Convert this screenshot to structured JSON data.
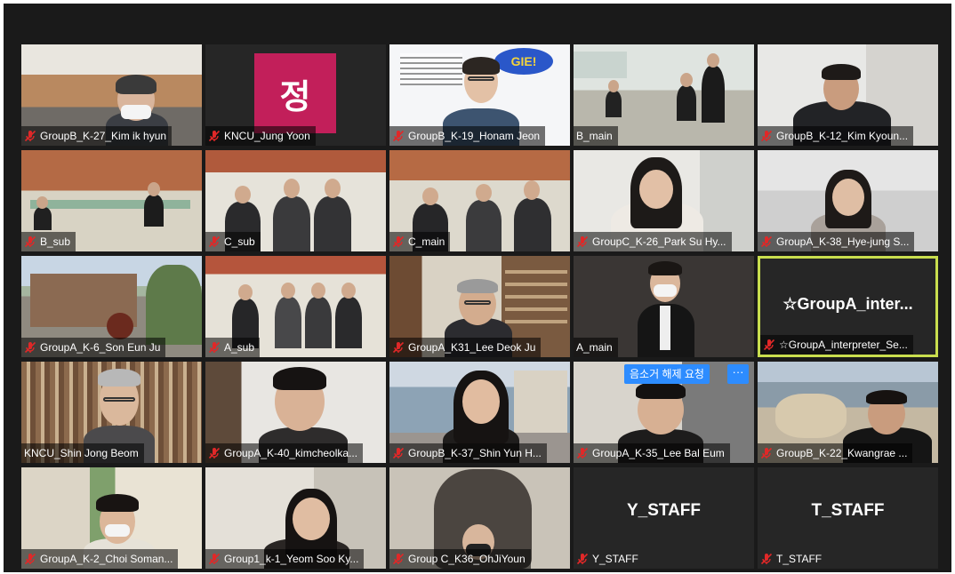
{
  "tiles": [
    {
      "name": "GroupB_K-27_Kim ik hyun",
      "muted": true
    },
    {
      "name": "KNCU_Jung Yoon",
      "muted": true,
      "avatar": "정"
    },
    {
      "name": "GroupB_K-19_Honam Jeon",
      "muted": true,
      "sign_text": "GIE!"
    },
    {
      "name": "B_main",
      "muted": false
    },
    {
      "name": "GroupB_K-12_Kim Kyoun...",
      "muted": true
    },
    {
      "name": "B_sub",
      "muted": true
    },
    {
      "name": "C_sub",
      "muted": true
    },
    {
      "name": "C_main",
      "muted": true
    },
    {
      "name": "GroupC_K-26_Park Su Hy...",
      "muted": true
    },
    {
      "name": "GroupA_K-38_Hye-jung S...",
      "muted": true
    },
    {
      "name": "GroupA_K-6_Son Eun Ju",
      "muted": true
    },
    {
      "name": "A_sub",
      "muted": true
    },
    {
      "name": "GroupA_K31_Lee Deok Ju",
      "muted": true
    },
    {
      "name": "A_main",
      "muted": false
    },
    {
      "name": "☆GroupA_interpreter_Se...",
      "muted": true,
      "display_text": "☆GroupA_inter...",
      "active_speaker": true
    },
    {
      "name": "KNCU_Shin Jong Beom",
      "muted": false
    },
    {
      "name": "GroupA_K-40_kimcheolka...",
      "muted": true
    },
    {
      "name": "GroupB_K-37_Shin Yun H...",
      "muted": true
    },
    {
      "name": "GroupA_K-35_Lee Bal Eum",
      "muted": true,
      "unmute_request": "음소거 해제 요청",
      "more": "···"
    },
    {
      "name": "GroupB_K-22_Kwangrae ...",
      "muted": true
    },
    {
      "name": "GroupA_K-2_Choi Soman...",
      "muted": true
    },
    {
      "name": "Group1_k-1_Yeom Soo Ky...",
      "muted": true
    },
    {
      "name": "Group C_K36_OhJiYoun",
      "muted": true
    },
    {
      "name": "Y_STAFF",
      "muted": true,
      "display_text": "Y_STAFF"
    },
    {
      "name": "T_STAFF",
      "muted": true,
      "display_text": "T_STAFF"
    }
  ]
}
